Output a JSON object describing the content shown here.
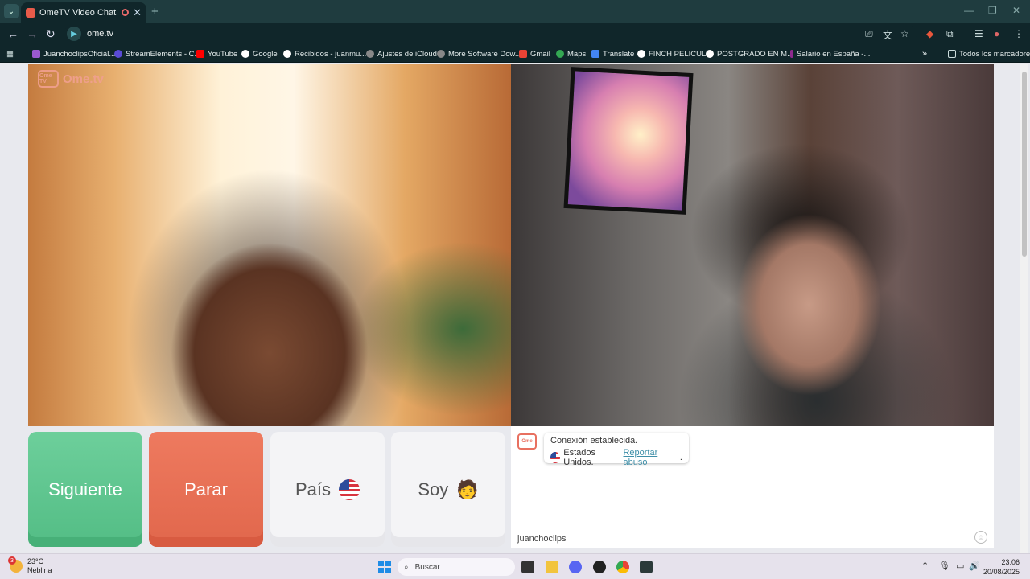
{
  "browser": {
    "tab_title": "OmeTV Video Chat — Ome",
    "url": "ome.tv",
    "bookmarks": [
      {
        "label": "JuanchoclipsOficial...",
        "color": "#9b59d0"
      },
      {
        "label": "StreamElements - C...",
        "color": "#5a4bd6"
      },
      {
        "label": "YouTube",
        "color": "#ff0000"
      },
      {
        "label": "Google",
        "color": "#ffffff"
      },
      {
        "label": "Recibidos - juanmu...",
        "color": "#ffffff"
      },
      {
        "label": "Ajustes de iCloud",
        "color": "#888888"
      },
      {
        "label": "More Software Dow...",
        "color": "#888888"
      },
      {
        "label": "Gmail",
        "color": "#ea4335"
      },
      {
        "label": "Maps",
        "color": "#34a853"
      },
      {
        "label": "Translate",
        "color": "#4285f4"
      },
      {
        "label": "FINCH PELICULA",
        "color": "#ffffff"
      },
      {
        "label": "POSTGRADO EN M...",
        "color": "#ffffff"
      },
      {
        "label": "Salario en España -...",
        "color": "#8e2a8e"
      }
    ],
    "all_bookmarks": "Todos los marcadores"
  },
  "site": {
    "logo_text": "Ome.tv",
    "logo_badge": "Ome TV"
  },
  "controls": {
    "next": "Siguiente",
    "stop": "Parar",
    "country": "País",
    "me": "Soy",
    "me_emoji": "🧑"
  },
  "chat": {
    "status": "Conexión establecida.",
    "country": "Estados Unidos.",
    "report": "Reportar abuso",
    "report_suffix": ".",
    "input_value": "juanchoclips"
  },
  "taskbar": {
    "weather_badge": "3",
    "temperature": "23°C",
    "condition": "Neblina",
    "search": "Buscar",
    "time": "23:06",
    "date": "20/08/2025"
  },
  "colors": {
    "next": "#5ec590",
    "stop": "#e86f54",
    "link": "#3f8fa8"
  }
}
